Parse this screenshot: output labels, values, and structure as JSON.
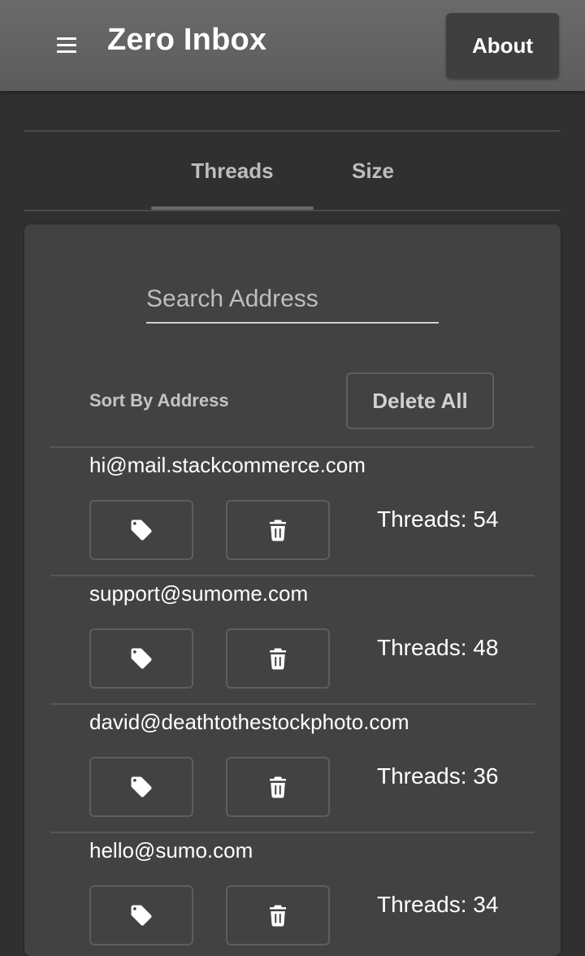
{
  "header": {
    "title": "Zero Inbox",
    "about_label": "About",
    "menu_icon": "hamburger-menu-icon"
  },
  "tabs": [
    {
      "label": "Threads",
      "active": true
    },
    {
      "label": "Size",
      "active": false
    }
  ],
  "search": {
    "placeholder": "Search Address",
    "value": ""
  },
  "controls": {
    "sort_label": "Sort By Address",
    "delete_all_label": "Delete All"
  },
  "senders": [
    {
      "address": "hi@mail.stackcommerce.com",
      "threads_text": "Threads: 54"
    },
    {
      "address": "support@sumome.com",
      "threads_text": "Threads: 48"
    },
    {
      "address": "david@deathtothestockphoto.com",
      "threads_text": "Threads: 36"
    },
    {
      "address": "hello@sumo.com",
      "threads_text": "Threads: 34"
    }
  ],
  "icons": {
    "tag": "tag-icon",
    "trash": "trash-icon"
  },
  "colors": {
    "background": "#303030",
    "appbar": "#616161",
    "card": "#424242",
    "text": "#ffffff",
    "muted_text": "#bdbdbd"
  }
}
